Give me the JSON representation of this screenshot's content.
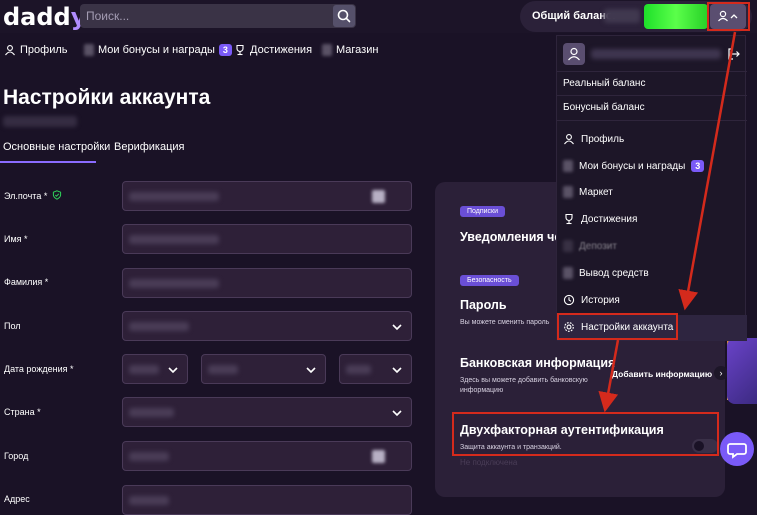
{
  "brand": {
    "logo_main": "dadd",
    "logo_accent": "y"
  },
  "search": {
    "placeholder": "Поиск..."
  },
  "header": {
    "balance_label": "Общий баланс:"
  },
  "nav": [
    {
      "label": "Профиль"
    },
    {
      "label": "Мои бонусы и награды",
      "badge": "3"
    },
    {
      "label": "Достижения"
    },
    {
      "label": "Магазин"
    }
  ],
  "page": {
    "title": "Настройки аккаунта",
    "tabs": [
      "Основные настройки",
      "Верификация"
    ]
  },
  "form": {
    "email_label": "Эл.почта *",
    "first_name_label": "Имя *",
    "last_name_label": "Фамилия *",
    "gender_label": "Пол",
    "birthdate_label": "Дата рождения *",
    "country_label": "Страна *",
    "city_label": "Город",
    "address_label": "Адрес"
  },
  "card": {
    "chip_subscriptions": "Подписки",
    "notifications_title": "Уведомления че",
    "chip_security": "Безопасность",
    "password_title": "Пароль",
    "password_desc": "Вы можете сменить пароль",
    "bank_title": "Банковская информация",
    "bank_desc": "Здесь вы можете добавить банковскую информацию",
    "bank_action": "Добавить информацию",
    "tfa_title": "Двухфакторная аутентификация",
    "tfa_desc": "Защита аккаунта и транзакций.",
    "tfa_status": "Не подключена"
  },
  "dropdown": {
    "real_balance": "Реальный баланс",
    "bonus_balance": "Бонусный баланс",
    "items": [
      {
        "label": "Профиль"
      },
      {
        "label": "Мои бонусы и награды",
        "badge": "3"
      },
      {
        "label": "Маркет"
      },
      {
        "label": "Достижения"
      },
      {
        "label": "Депозит"
      },
      {
        "label": "Вывод средств"
      },
      {
        "label": "История"
      },
      {
        "label": "Настройки аккаунта"
      }
    ]
  },
  "colors": {
    "accent": "#7a5af8",
    "highlight": "#d42a1c",
    "deposit": "#3cf03a",
    "background": "#1a1226"
  }
}
